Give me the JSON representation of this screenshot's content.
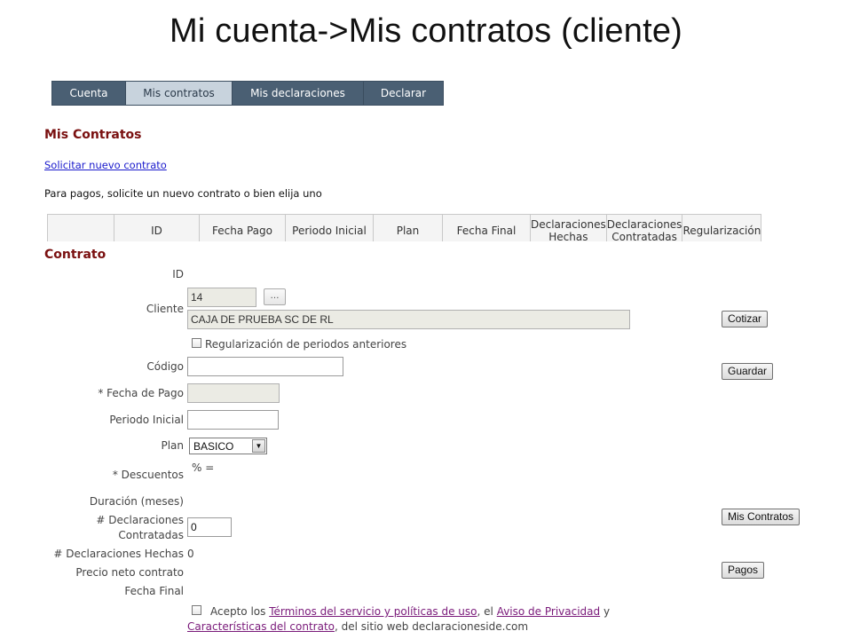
{
  "slide_title": "Mi cuenta->Mis contratos (cliente)",
  "nav": {
    "items": [
      {
        "label": "Cuenta"
      },
      {
        "label": "Mis contratos"
      },
      {
        "label": "Mis declaraciones"
      },
      {
        "label": "Declarar"
      }
    ],
    "active": "Mis contratos"
  },
  "mis_contratos": {
    "heading": "Mis Contratos",
    "new_contract_link": "Solicitar nuevo contrato",
    "instruction": "Para pagos, solicite un nuevo contrato o bien elija uno",
    "table_headers": [
      "",
      "ID",
      "Fecha Pago",
      "Periodo Inicial",
      "Plan",
      "Fecha Final",
      "Declaraciones Hechas",
      "Declaraciones Contratadas",
      "Regularización"
    ]
  },
  "contrato": {
    "heading": "Contrato",
    "labels": {
      "id": "ID",
      "cliente": "Cliente",
      "codigo": "Código",
      "fecha_pago": "* Fecha de Pago",
      "periodo_inicial": "Periodo Inicial",
      "plan": "Plan",
      "descuentos": "* Descuentos",
      "duracion": "Duración (meses)",
      "declaraciones_contratadas_1": "# Declaraciones",
      "declaraciones_contratadas_2": "Contratadas",
      "declaraciones_hechas": "# Declaraciones Hechas",
      "precio_neto": "Precio neto contrato",
      "fecha_final": "Fecha Final"
    },
    "values": {
      "cliente_id": "14",
      "cliente_lookup": "…",
      "cliente_nombre": "CAJA DE PRUEBA SC DE RL",
      "codigo": "",
      "fecha_pago": "",
      "periodo_inicial": "",
      "plan": "BASICO",
      "descuentos": "% =",
      "declaraciones_contratadas": "0",
      "declaraciones_hechas": "0"
    },
    "regularizacion_label": "Regularización de periodos anteriores",
    "buttons": {
      "cotizar": "Cotizar",
      "guardar": "Guardar",
      "mis_contratos": "Mis Contratos",
      "pagos": "Pagos"
    },
    "terms": {
      "prefix": "Acepto los",
      "link1": "Términos del servicio y políticas de uso",
      "sep1": ", el",
      "link2": "Aviso de Privacidad",
      "sep2": "y",
      "link3": "Características del contrato",
      "suffix": ", del sitio web declaracioneside.com"
    }
  }
}
